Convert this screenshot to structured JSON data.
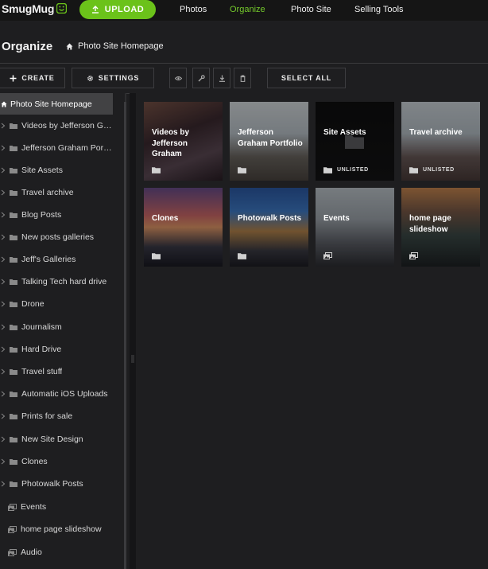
{
  "app": {
    "logo": "SmugMug",
    "upload_label": "UPLOAD",
    "nav": [
      "Photos",
      "Organize",
      "Photo Site",
      "Selling Tools"
    ],
    "active_nav": "Organize"
  },
  "header": {
    "title": "Organize",
    "breadcrumb": "Photo Site Homepage"
  },
  "toolbar": {
    "create": "CREATE",
    "settings": "SETTINGS",
    "select_all": "SELECT ALL",
    "icons": [
      "eye-icon",
      "wrench-icon",
      "download-icon",
      "trash-icon"
    ]
  },
  "sidebar": {
    "selected": "Photo Site Homepage",
    "items": [
      {
        "label": "Videos by Jefferson Graham",
        "type": "folder"
      },
      {
        "label": "Jefferson Graham Portfolio",
        "type": "folder"
      },
      {
        "label": "Site Assets",
        "type": "folder"
      },
      {
        "label": "Travel archive",
        "type": "folder"
      },
      {
        "label": "Blog Posts",
        "type": "folder"
      },
      {
        "label": "New posts galleries",
        "type": "folder"
      },
      {
        "label": "Jeff's Galleries",
        "type": "folder"
      },
      {
        "label": "Talking Tech hard drive",
        "type": "folder"
      },
      {
        "label": "Drone",
        "type": "folder"
      },
      {
        "label": "Journalism",
        "type": "folder"
      },
      {
        "label": "Hard Drive",
        "type": "folder"
      },
      {
        "label": "Travel stuff",
        "type": "folder"
      },
      {
        "label": "Automatic iOS Uploads",
        "type": "folder"
      },
      {
        "label": "Prints for sale",
        "type": "folder"
      },
      {
        "label": "New Site Design",
        "type": "folder"
      },
      {
        "label": "Clones",
        "type": "folder"
      },
      {
        "label": "Photowalk Posts",
        "type": "folder"
      },
      {
        "label": "Events",
        "type": "gallery"
      },
      {
        "label": "home page slideshow",
        "type": "gallery"
      },
      {
        "label": "Audio",
        "type": "gallery"
      }
    ]
  },
  "grid": {
    "tiles": [
      {
        "title": "Videos by Jefferson Graham",
        "type": "folder",
        "badge": ""
      },
      {
        "title": "Jefferson Graham Portfolio",
        "type": "folder",
        "badge": ""
      },
      {
        "title": "Site Assets",
        "type": "folder",
        "badge": "UNLISTED"
      },
      {
        "title": "Travel archive",
        "type": "folder",
        "badge": "UNLISTED"
      },
      {
        "title": "Clones",
        "type": "folder",
        "badge": ""
      },
      {
        "title": "Photowalk Posts",
        "type": "folder",
        "badge": ""
      },
      {
        "title": "Events",
        "type": "gallery",
        "badge": ""
      },
      {
        "title": "home page slideshow",
        "type": "gallery",
        "badge": ""
      }
    ]
  },
  "colors": {
    "accent": "#6bc21a",
    "background": "#1e1e20",
    "topbar": "#151515",
    "selected_row": "#424244"
  }
}
